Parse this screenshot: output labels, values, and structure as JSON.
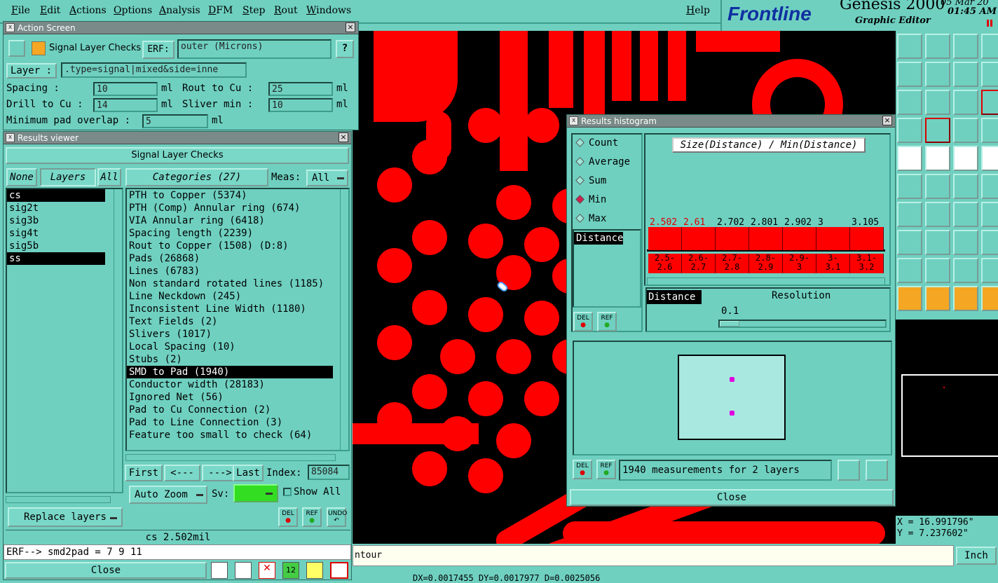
{
  "menubar": {
    "items": [
      "File",
      "Edit",
      "Actions",
      "Options",
      "Analysis",
      "DFM",
      "Step",
      "Rout",
      "Windows"
    ],
    "help": "Help"
  },
  "brand": {
    "logo": "Frontline",
    "product": "Genesis 2000",
    "subtitle": "Graphic Editor",
    "date": "05 Mar 20",
    "time": "01:45 AM"
  },
  "action_screen": {
    "title": "Action Screen",
    "check_name": "Signal Layer Checks",
    "erf_label": "ERF:",
    "erf_value": "outer (Microns)",
    "help": "?",
    "layer_label": "Layer :",
    "layer_value": ".type=signal|mixed&side=inne",
    "params": [
      {
        "label": "Spacing        :",
        "value": "10",
        "unit": "ml"
      },
      {
        "label": "Rout to Cu  :",
        "value": "25",
        "unit": "ml"
      },
      {
        "label": "Drill to Cu :",
        "value": "14",
        "unit": "ml"
      },
      {
        "label": "Sliver min  :",
        "value": "10",
        "unit": "ml"
      }
    ],
    "min_pad_label": "Minimum pad overlap :",
    "min_pad_value": "5",
    "min_pad_unit": "ml"
  },
  "results_viewer": {
    "title": "Results viewer",
    "header": "Signal Layer Checks",
    "none": "None",
    "layers_tab": "Layers",
    "all": "All",
    "categories_tab": "Categories (27)",
    "meas_label": "Meas:",
    "meas_value": "All",
    "layers": [
      "cs",
      "sig2t",
      "sig3b",
      "sig4t",
      "sig5b",
      "ss"
    ],
    "categories": [
      "PTH to Copper (5374)",
      "PTH (Comp) Annular ring (674)",
      "VIA Annular ring (6418)",
      "Spacing length (2239)",
      "Rout to Copper (1508)     (D:8)",
      "Pads (26868)",
      "Lines (6783)",
      "Non standard rotated lines (1185)",
      "Line Neckdown (245)",
      "Inconsistent Line Width (1180)",
      "Text Fields (2)",
      "Slivers (1017)",
      "Local Spacing (10)",
      "Stubs (2)",
      "SMD to Pad (1940)",
      "Conductor width (28183)",
      "Ignored Net (56)",
      "Pad to Cu Connection (2)",
      "Pad to Line Connection (3)",
      "Feature too small to check (64)"
    ],
    "selected_category": "SMD to Pad (1940)",
    "nav": {
      "first": "First",
      "prev": "<---",
      "next": "--->",
      "last": "Last",
      "index_label": "Index:",
      "index_value": "85084"
    },
    "auto_zoom": "Auto Zoom",
    "sv_label": "Sv:",
    "show_all": "Show All",
    "replace_layers": "Replace layers",
    "del": "DEL",
    "ref": "REF",
    "undo": "UNDO",
    "status": "cs 2.502mil",
    "erf_line": "ERF--> smd2pad = 7 9 11",
    "close": "Close"
  },
  "histogram": {
    "title": "Results histogram",
    "heading": "Size(Distance) / Min(Distance)",
    "modes": [
      "Count",
      "Average",
      "Sum",
      "Min",
      "Max"
    ],
    "mode_selected": "Min",
    "attr_list": [
      "Distance"
    ],
    "attr_selected": "Distance",
    "resolution_label": "Resolution",
    "resolution_value": "0.1",
    "footer_text": "1940 measurements for 2 layers",
    "close": "Close",
    "del": "DEL",
    "ref": "REF"
  },
  "chart_data": {
    "type": "bar",
    "title": "Size(Distance) / Min(Distance)",
    "categories": [
      "2.5-2.6",
      "2.6-2.7",
      "2.7-2.8",
      "2.8-2.9",
      "2.9-3",
      "3-3.1",
      "3.1-3.2"
    ],
    "values": [
      2.502,
      2.61,
      2.702,
      2.801,
      2.902,
      3,
      3.105
    ],
    "value_labels": [
      "2.502",
      "2.61",
      "2.702",
      "2.801",
      "2.902",
      "3",
      "3.105"
    ],
    "range_labels": [
      [
        "2.5-",
        "2.6"
      ],
      [
        "2.6-",
        "2.7"
      ],
      [
        "2.7-",
        "2.8"
      ],
      [
        "2.8-",
        "2.9"
      ],
      [
        "2.9-",
        "3"
      ],
      [
        "3-",
        "3.1"
      ],
      [
        "3.1-",
        "3.2"
      ]
    ],
    "highlight_color": "#ff0000"
  },
  "coords": {
    "x": "X = 16.991796\"",
    "y": "Y = 7.237602\""
  },
  "bottom": {
    "contour": "ntour",
    "units": "Inch",
    "dx_line": "DX=0.0017455 DY=0.0017977 D=0.0025056"
  },
  "colors": {
    "panel": "#6fd0c0",
    "copper": "#ff0000",
    "canvas": "#000000",
    "sv_toggle": "#33dd22"
  }
}
